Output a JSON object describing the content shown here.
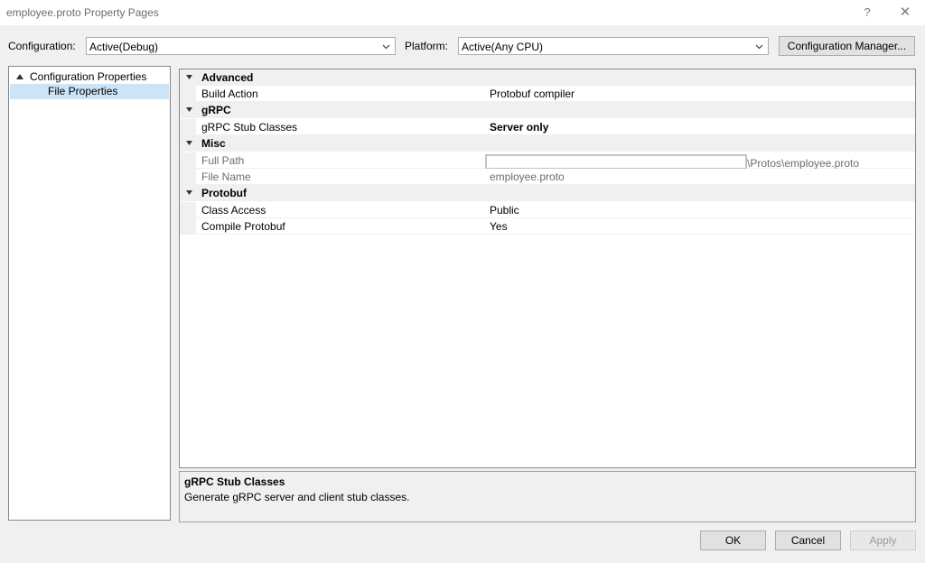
{
  "window": {
    "title": "employee.proto Property Pages",
    "help_glyph": "?",
    "close_glyph": "✕"
  },
  "toolbar": {
    "configuration_label": "Configuration:",
    "configuration_value": "Active(Debug)",
    "platform_label": "Platform:",
    "platform_value": "Active(Any CPU)",
    "config_manager_label": "Configuration Manager..."
  },
  "tree": {
    "root_label": "Configuration Properties",
    "child_label": "File Properties"
  },
  "grid": {
    "categories": [
      {
        "name": "Advanced",
        "props": [
          {
            "name": "Build Action",
            "value": "Protobuf compiler"
          }
        ]
      },
      {
        "name": "gRPC",
        "props": [
          {
            "name": "gRPC Stub Classes",
            "value": "Server only"
          }
        ]
      },
      {
        "name": "Misc",
        "props": [
          {
            "name": "Full Path",
            "value": "\\Protos\\employee.proto"
          },
          {
            "name": "File Name",
            "value": "employee.proto"
          }
        ]
      },
      {
        "name": "Protobuf",
        "props": [
          {
            "name": "Class Access",
            "value": "Public"
          },
          {
            "name": "Compile Protobuf",
            "value": "Yes"
          }
        ]
      }
    ]
  },
  "description": {
    "title": "gRPC Stub Classes",
    "text": "Generate gRPC server and client stub classes."
  },
  "buttons": {
    "ok": "OK",
    "cancel": "Cancel",
    "apply": "Apply"
  },
  "icons": {
    "dropdown": "chevron-down-icon",
    "expand": "expanded-triangle-icon"
  }
}
